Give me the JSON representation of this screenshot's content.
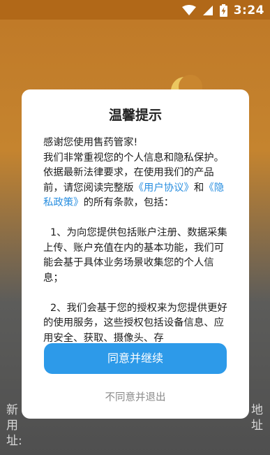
{
  "status_bar": {
    "time": "3:24",
    "icons": [
      "wifi-icon",
      "signal-icon",
      "battery-charging-icon"
    ]
  },
  "background": {
    "left_text": "新用\n址:",
    "right_text": "地\n址"
  },
  "dialog": {
    "title": "温馨提示",
    "greeting": "感谢您使用售药管家!",
    "p1_before": "我们非常重视您的个人信息和隐私保护。依据最新法律要求，在使用我们的产品前，请您阅读完整版",
    "link_user_agreement": "《用户协议》",
    "p1_and": "和",
    "link_privacy_policy": "《隐私政策》",
    "p1_after": "的所有条款，包括：",
    "clause_1": "1、为向您提供包括账户注册、数据采集上传、账户充值在内的基本功能，我们可能会基于具体业务场景收集您的个人信息；",
    "clause_2": "2、我们会基于您的授权来为您提供更好的使用服务，这些授权包括设备信息、应用安全、获取、摄像头、存",
    "agree_button": "同意并继续",
    "reject_button": "不同意并退出"
  },
  "colors": {
    "accent": "#2d9ae9",
    "link": "#2a8fe0",
    "splash_orange": "#c5842f"
  }
}
